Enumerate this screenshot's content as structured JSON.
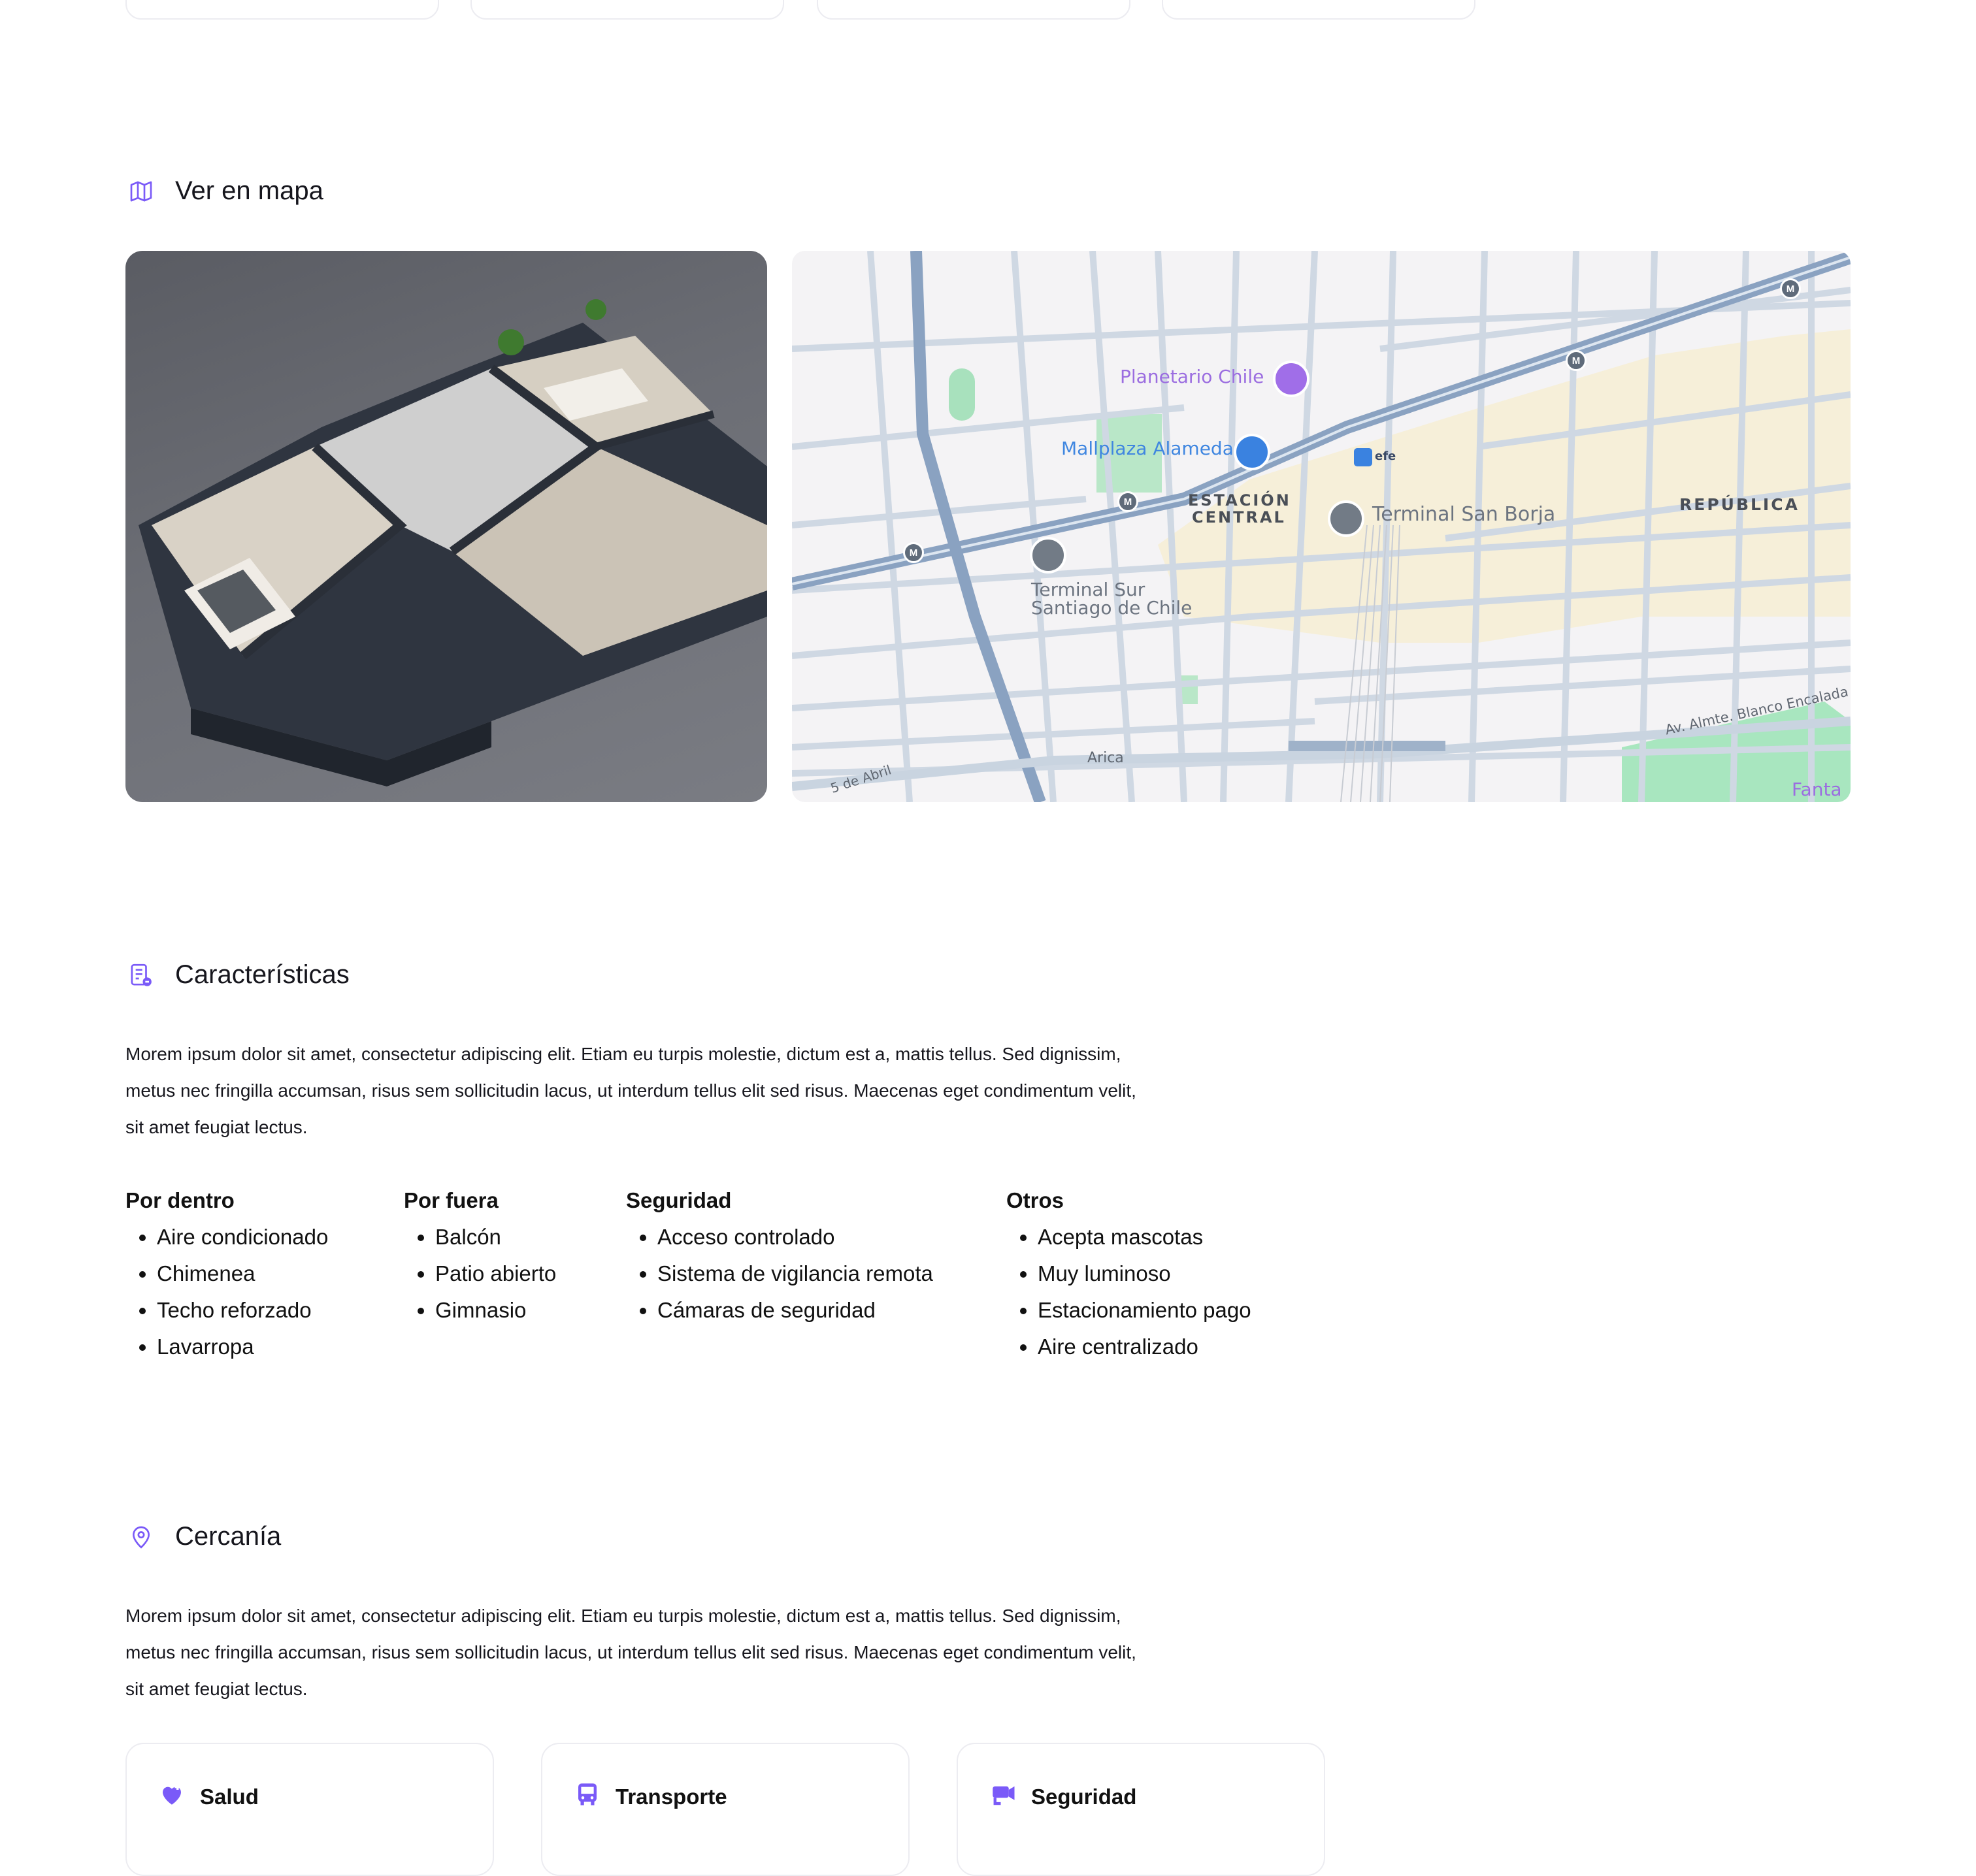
{
  "colors": {
    "accent": "#7a5af8",
    "text": "#16161d",
    "card_border": "#ececf1"
  },
  "map_section": {
    "title": "Ver en mapa",
    "icon": "map-icon",
    "map_labels": {
      "planetario": "Planetario Chile",
      "mallplaza": "Mallplaza Alameda",
      "efe": "efe",
      "estacion_central_1": "ESTACIÓN",
      "estacion_central_2": "CENTRAL",
      "terminal_san_borja": "Terminal San Borja",
      "republica": "REPÚBLICA",
      "terminal_sur_1": "Terminal Sur",
      "terminal_sur_2": "Santiago de Chile",
      "arica": "Arica",
      "cinco_abril": "5 de Abril",
      "almte": "Av. Almte. Blanco Encalada",
      "fantasilandia": "Fanta",
      "metro": "M"
    }
  },
  "features": {
    "title": "Características",
    "icon": "features-list-icon",
    "description": "Morem ipsum dolor sit amet, consectetur adipiscing elit. Etiam eu turpis molestie, dictum est a, mattis tellus. Sed dignissim, metus nec fringilla accumsan, risus sem sollicitudin lacus, ut interdum tellus elit sed risus. Maecenas eget condimentum velit, sit amet feugiat lectus.",
    "columns": [
      {
        "heading": "Por dentro",
        "items": [
          "Aire condicionado",
          "Chimenea",
          "Techo reforzado",
          "Lavarropa"
        ]
      },
      {
        "heading": "Por fuera",
        "items": [
          "Balcón",
          "Patio abierto",
          "Gimnasio"
        ]
      },
      {
        "heading": "Seguridad",
        "items": [
          "Acceso controlado",
          "Sistema de vigilancia remota",
          "Cámaras de seguridad"
        ]
      },
      {
        "heading": "Otros",
        "items": [
          "Acepta mascotas",
          "Muy luminoso",
          "Estacionamiento pago",
          "Aire centralizado"
        ]
      }
    ]
  },
  "proximity": {
    "title": "Cercanía",
    "icon": "location-pin-icon",
    "description": "Morem ipsum dolor sit amet, consectetur adipiscing elit. Etiam eu turpis molestie, dictum est a, mattis tellus. Sed dignissim, metus nec fringilla accumsan, risus sem sollicitudin lacus, ut interdum tellus elit sed risus. Maecenas eget condimentum velit, sit amet feugiat lectus.",
    "cards": [
      {
        "label": "Salud",
        "icon": "heart-plus-icon"
      },
      {
        "label": "Transporte",
        "icon": "bus-icon"
      },
      {
        "label": "Seguridad",
        "icon": "security-camera-icon"
      }
    ]
  }
}
